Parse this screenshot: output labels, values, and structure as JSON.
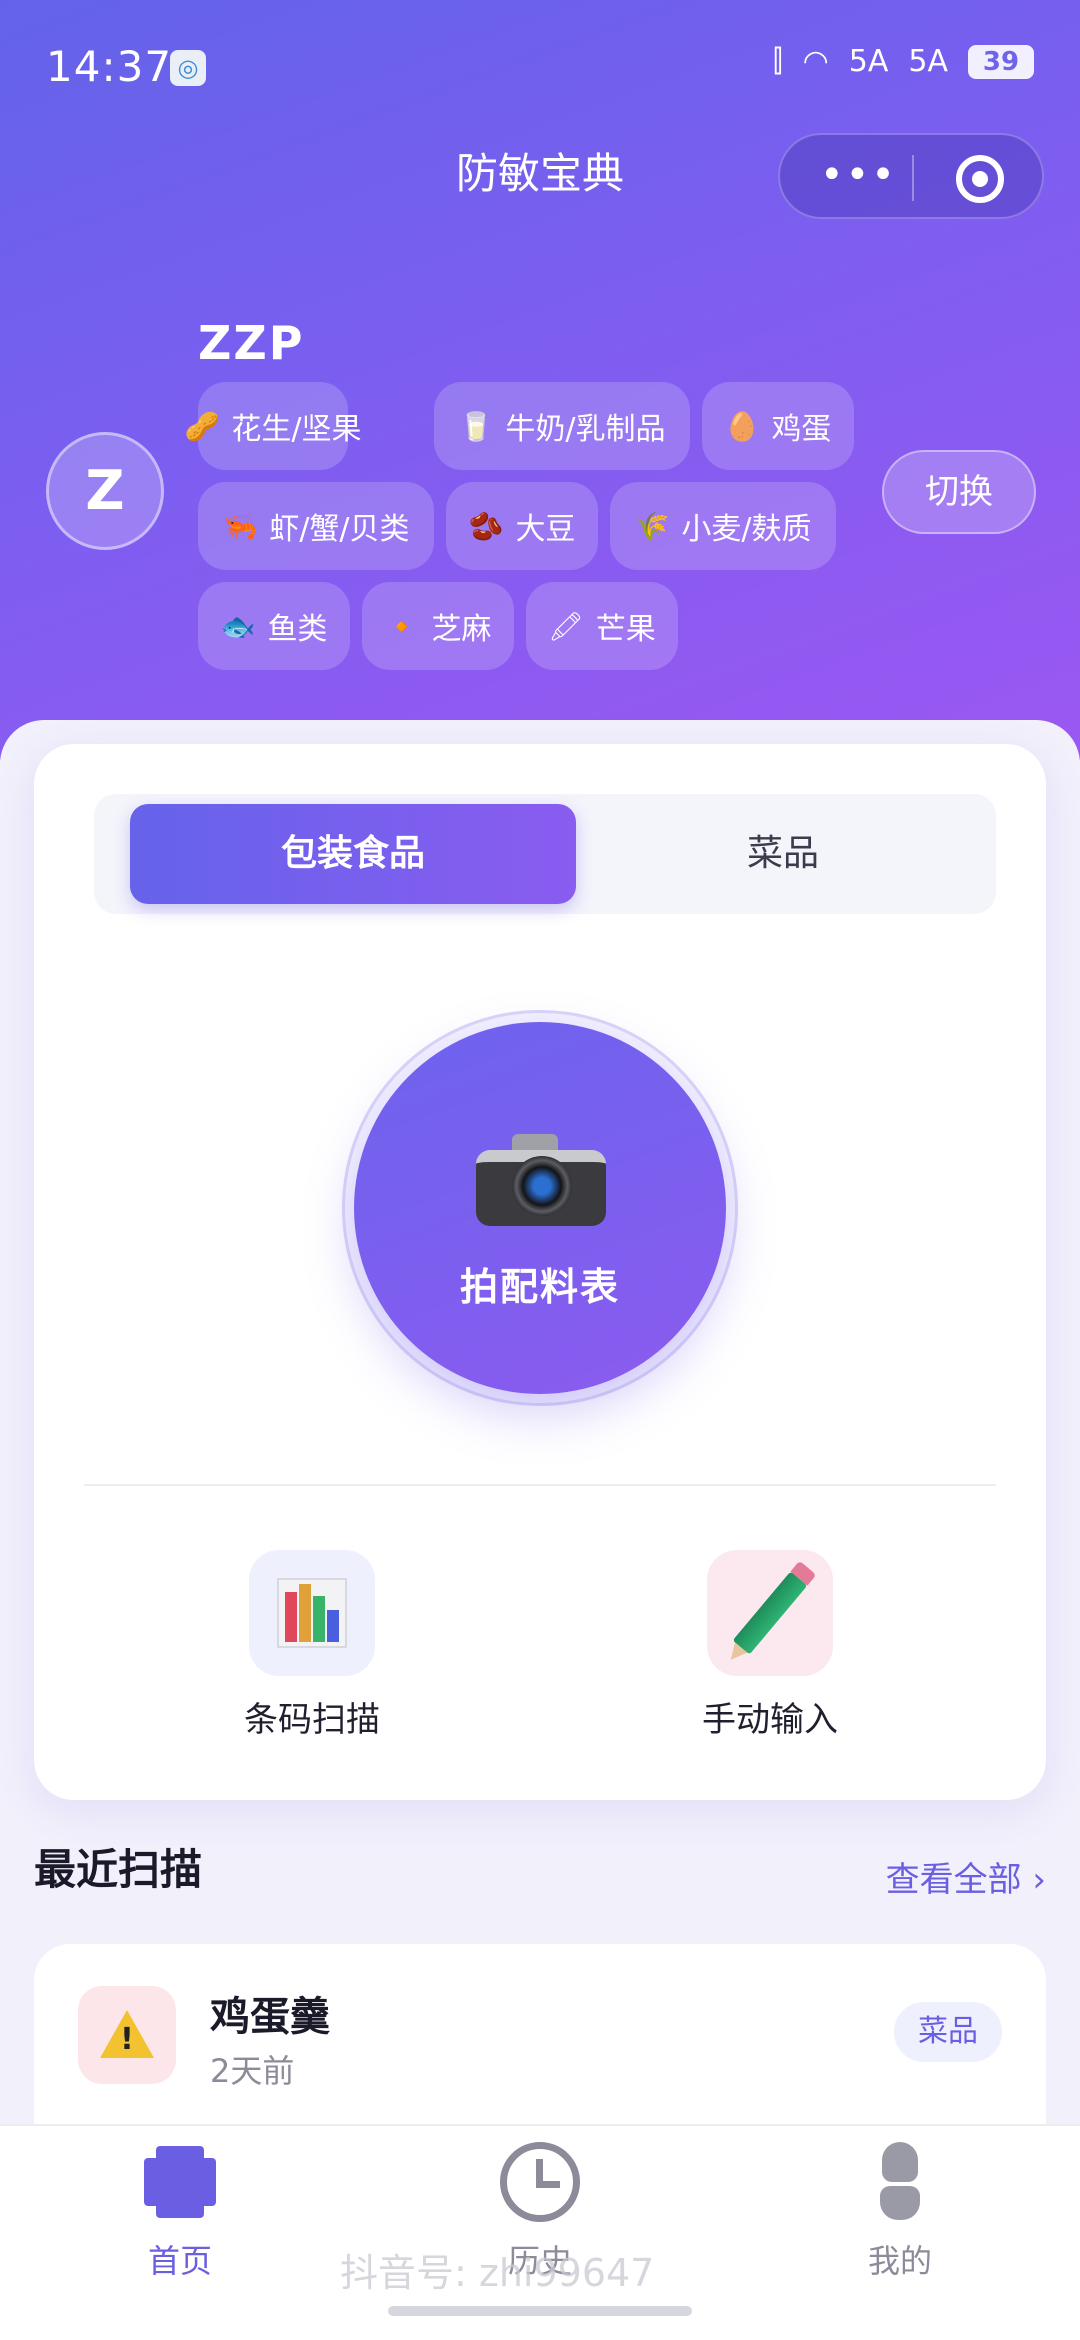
{
  "status_bar": {
    "time": "14:37",
    "signal_1": "5A",
    "signal_2": "5A",
    "battery": "39"
  },
  "nav": {
    "title": "防敏宝典",
    "more_glyph": "•••"
  },
  "profile": {
    "avatar_letter": "Z",
    "name": "ZZP",
    "switch_label": "切换",
    "allergens": [
      {
        "icon": "🥜",
        "label": "花生/坚果"
      },
      {
        "icon": "🥛",
        "label": "牛奶/乳制品"
      },
      {
        "icon": "🥚",
        "label": "鸡蛋"
      },
      {
        "icon": "🦐",
        "label": "虾/蟹/贝类"
      },
      {
        "icon": "🫘",
        "label": "大豆"
      },
      {
        "icon": "🌾",
        "label": "小麦/麸质"
      },
      {
        "icon": "🐟",
        "label": "鱼类"
      },
      {
        "icon": "🔸",
        "label": "芝麻"
      },
      {
        "icon": "🖍",
        "label": "芒果"
      }
    ]
  },
  "scan_mode": {
    "tabs": [
      {
        "label": "包装食品",
        "active": true
      },
      {
        "label": "菜品",
        "active": false
      }
    ],
    "shoot_label": "拍配料表"
  },
  "quick_actions": [
    {
      "label": "条码扫描",
      "icon": "bar-chart-icon"
    },
    {
      "label": "手动输入",
      "icon": "pencil-icon"
    }
  ],
  "recent": {
    "title": "最近扫描",
    "see_all": "查看全部 ›",
    "items": [
      {
        "name": "鸡蛋羹",
        "time": "2天前",
        "badge": "菜品",
        "icon": "warning-icon"
      }
    ]
  },
  "tabbar": {
    "items": [
      {
        "label": "首页",
        "active": true
      },
      {
        "label": "历史",
        "active": false
      },
      {
        "label": "我的",
        "active": false
      }
    ]
  },
  "watermark": "抖音号: zhi99647",
  "colors": {
    "primary": "#6a5fe3",
    "hero_start": "#6363e9",
    "hero_end": "#9c57f2",
    "warning": "#f2c230"
  }
}
